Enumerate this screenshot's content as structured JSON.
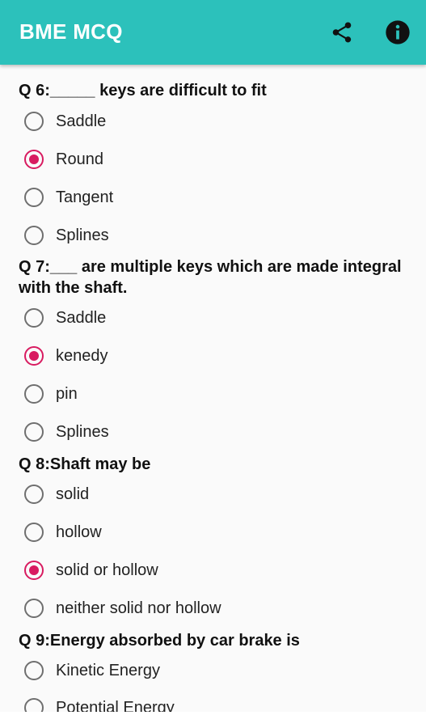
{
  "app": {
    "title": "BME MCQ",
    "accent_color": "#2cc1bb",
    "radio_checked_color": "#d81b60",
    "actions": [
      {
        "icon": "share-icon"
      },
      {
        "icon": "info-icon"
      }
    ]
  },
  "questions": [
    {
      "text": "Q 6:_____ keys are difficult to fit",
      "options": [
        {
          "label": "Saddle",
          "checked": false
        },
        {
          "label": "Round",
          "checked": true
        },
        {
          "label": "Tangent",
          "checked": false
        },
        {
          "label": "Splines",
          "checked": false
        }
      ]
    },
    {
      "text": "Q 7:___ are multiple keys which are made integral with the shaft.",
      "options": [
        {
          "label": "Saddle",
          "checked": false
        },
        {
          "label": "kenedy",
          "checked": true
        },
        {
          "label": "pin",
          "checked": false
        },
        {
          "label": "Splines",
          "checked": false
        }
      ]
    },
    {
      "text": "Q 8:Shaft may be",
      "options": [
        {
          "label": "solid",
          "checked": false
        },
        {
          "label": "hollow",
          "checked": false
        },
        {
          "label": "solid or hollow",
          "checked": true
        },
        {
          "label": "neither solid nor hollow",
          "checked": false
        }
      ]
    },
    {
      "text": "Q 9:Energy absorbed by car brake is",
      "options": [
        {
          "label": "Kinetic Energy",
          "checked": false
        },
        {
          "label": "Potential Energy",
          "checked": false
        }
      ]
    }
  ]
}
